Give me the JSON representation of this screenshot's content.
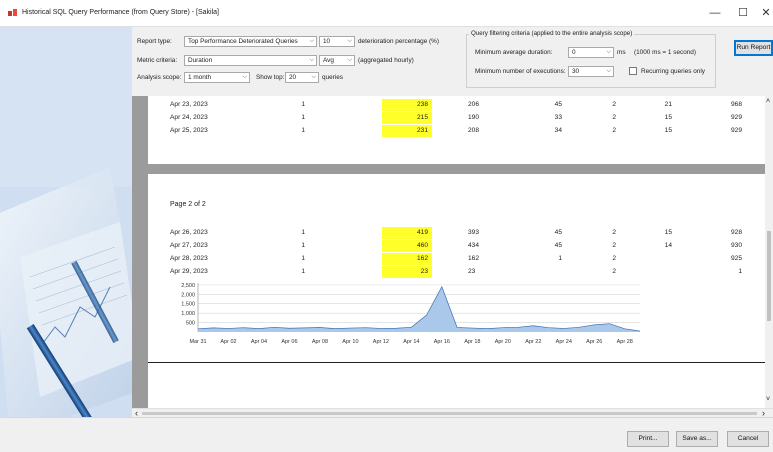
{
  "window": {
    "title": "Historical SQL Query Performance (from Query Store) - [Sakila]",
    "minimize_glyph": "—",
    "maximize_glyph": "☐",
    "close_glyph": "✕"
  },
  "controls": {
    "report_type_label": "Report type:",
    "report_type_value": "Top Performance Deteriorated Queries",
    "deterioration_value": "10",
    "deterioration_label": "deterioration percentage (%)",
    "metric_label": "Metric criteria:",
    "metric_value": "Duration",
    "aggregate_value": "Avg",
    "aggregate_label": "(aggregated hourly)",
    "scope_label": "Analysis scope:",
    "scope_value": "1 month",
    "show_top_label": "Show top:",
    "show_top_value": "20",
    "queries_label": "queries",
    "filter_group_label": "Query filtering criteria (applied to the entire analysis scope)",
    "min_duration_label": "Minimum average duration:",
    "min_duration_value": "0",
    "ms_label": "ms",
    "ms_note": "(1000 ms = 1 second)",
    "min_exec_label": "Minimum number of executions:",
    "min_exec_value": "30",
    "recurring_label": "Recurring queries only",
    "run_report_label": "Run Report"
  },
  "page1_rows": [
    {
      "date": "Apr 23, 2023",
      "c1": "1",
      "c2": "238",
      "c3": "206",
      "c4": "45",
      "c5": "2",
      "c6": "21",
      "c7": "968"
    },
    {
      "date": "Apr 24, 2023",
      "c1": "1",
      "c2": "215",
      "c3": "190",
      "c4": "33",
      "c5": "2",
      "c6": "15",
      "c7": "929"
    },
    {
      "date": "Apr 25, 2023",
      "c1": "1",
      "c2": "231",
      "c3": "208",
      "c4": "34",
      "c5": "2",
      "c6": "15",
      "c7": "929"
    }
  ],
  "page2": {
    "header": "Page 2 of 2",
    "rows": [
      {
        "date": "Apr 26, 2023",
        "c1": "1",
        "c2": "419",
        "c3": "393",
        "c4": "45",
        "c5": "2",
        "c6": "15",
        "c7": "928"
      },
      {
        "date": "Apr 27, 2023",
        "c1": "1",
        "c2": "460",
        "c3": "434",
        "c4": "45",
        "c5": "2",
        "c6": "14",
        "c7": "930"
      },
      {
        "date": "Apr 28, 2023",
        "c1": "1",
        "c2": "162",
        "c3": "162",
        "c4": "1",
        "c5": "2",
        "c6": "",
        "c7": "925"
      },
      {
        "date": "Apr 29, 2023",
        "c1": "1",
        "c2": "23",
        "c3": "23",
        "c4": "",
        "c5": "2",
        "c6": "",
        "c7": "1"
      }
    ]
  },
  "colors": {
    "highlight": "#ffff29",
    "series_fill": "#a9c8ea",
    "series_line": "#3b6fb1",
    "run_button_border": "#0078d7"
  },
  "chart_data": {
    "type": "area",
    "x": [
      "Mar 31",
      "Apr 01",
      "Apr 02",
      "Apr 03",
      "Apr 04",
      "Apr 05",
      "Apr 06",
      "Apr 07",
      "Apr 08",
      "Apr 09",
      "Apr 10",
      "Apr 11",
      "Apr 12",
      "Apr 13",
      "Apr 14",
      "Apr 15",
      "Apr 16",
      "Apr 17",
      "Apr 18",
      "Apr 19",
      "Apr 20",
      "Apr 21",
      "Apr 22",
      "Apr 23",
      "Apr 24",
      "Apr 25",
      "Apr 26",
      "Apr 27",
      "Apr 28",
      "Apr 29"
    ],
    "y": [
      170,
      220,
      190,
      230,
      180,
      250,
      200,
      220,
      240,
      180,
      210,
      230,
      190,
      200,
      250,
      900,
      2400,
      240,
      210,
      180,
      230,
      250,
      330,
      230,
      190,
      250,
      380,
      440,
      170,
      50
    ],
    "xtick_labels": [
      "Mar 31",
      "Apr 02",
      "Apr 04",
      "Apr 06",
      "Apr 08",
      "Apr 10",
      "Apr 12",
      "Apr 14",
      "Apr 16",
      "Apr 18",
      "Apr 20",
      "Apr 22",
      "Apr 24",
      "Apr 26",
      "Apr 28"
    ],
    "ytick_labels": [
      "2,500",
      "2,000",
      "1,500",
      "1,000",
      "500"
    ],
    "ytick_values": [
      2500,
      2000,
      1500,
      1000,
      500
    ],
    "ylim": [
      0,
      2600
    ],
    "grid": true
  },
  "buttons": {
    "print": "Print...",
    "save_as": "Save as...",
    "cancel": "Cancel"
  },
  "scroll": {
    "left_arrow": "‹",
    "right_arrow": "›",
    "up_arrow": "˄",
    "down_arrow": "˅"
  }
}
